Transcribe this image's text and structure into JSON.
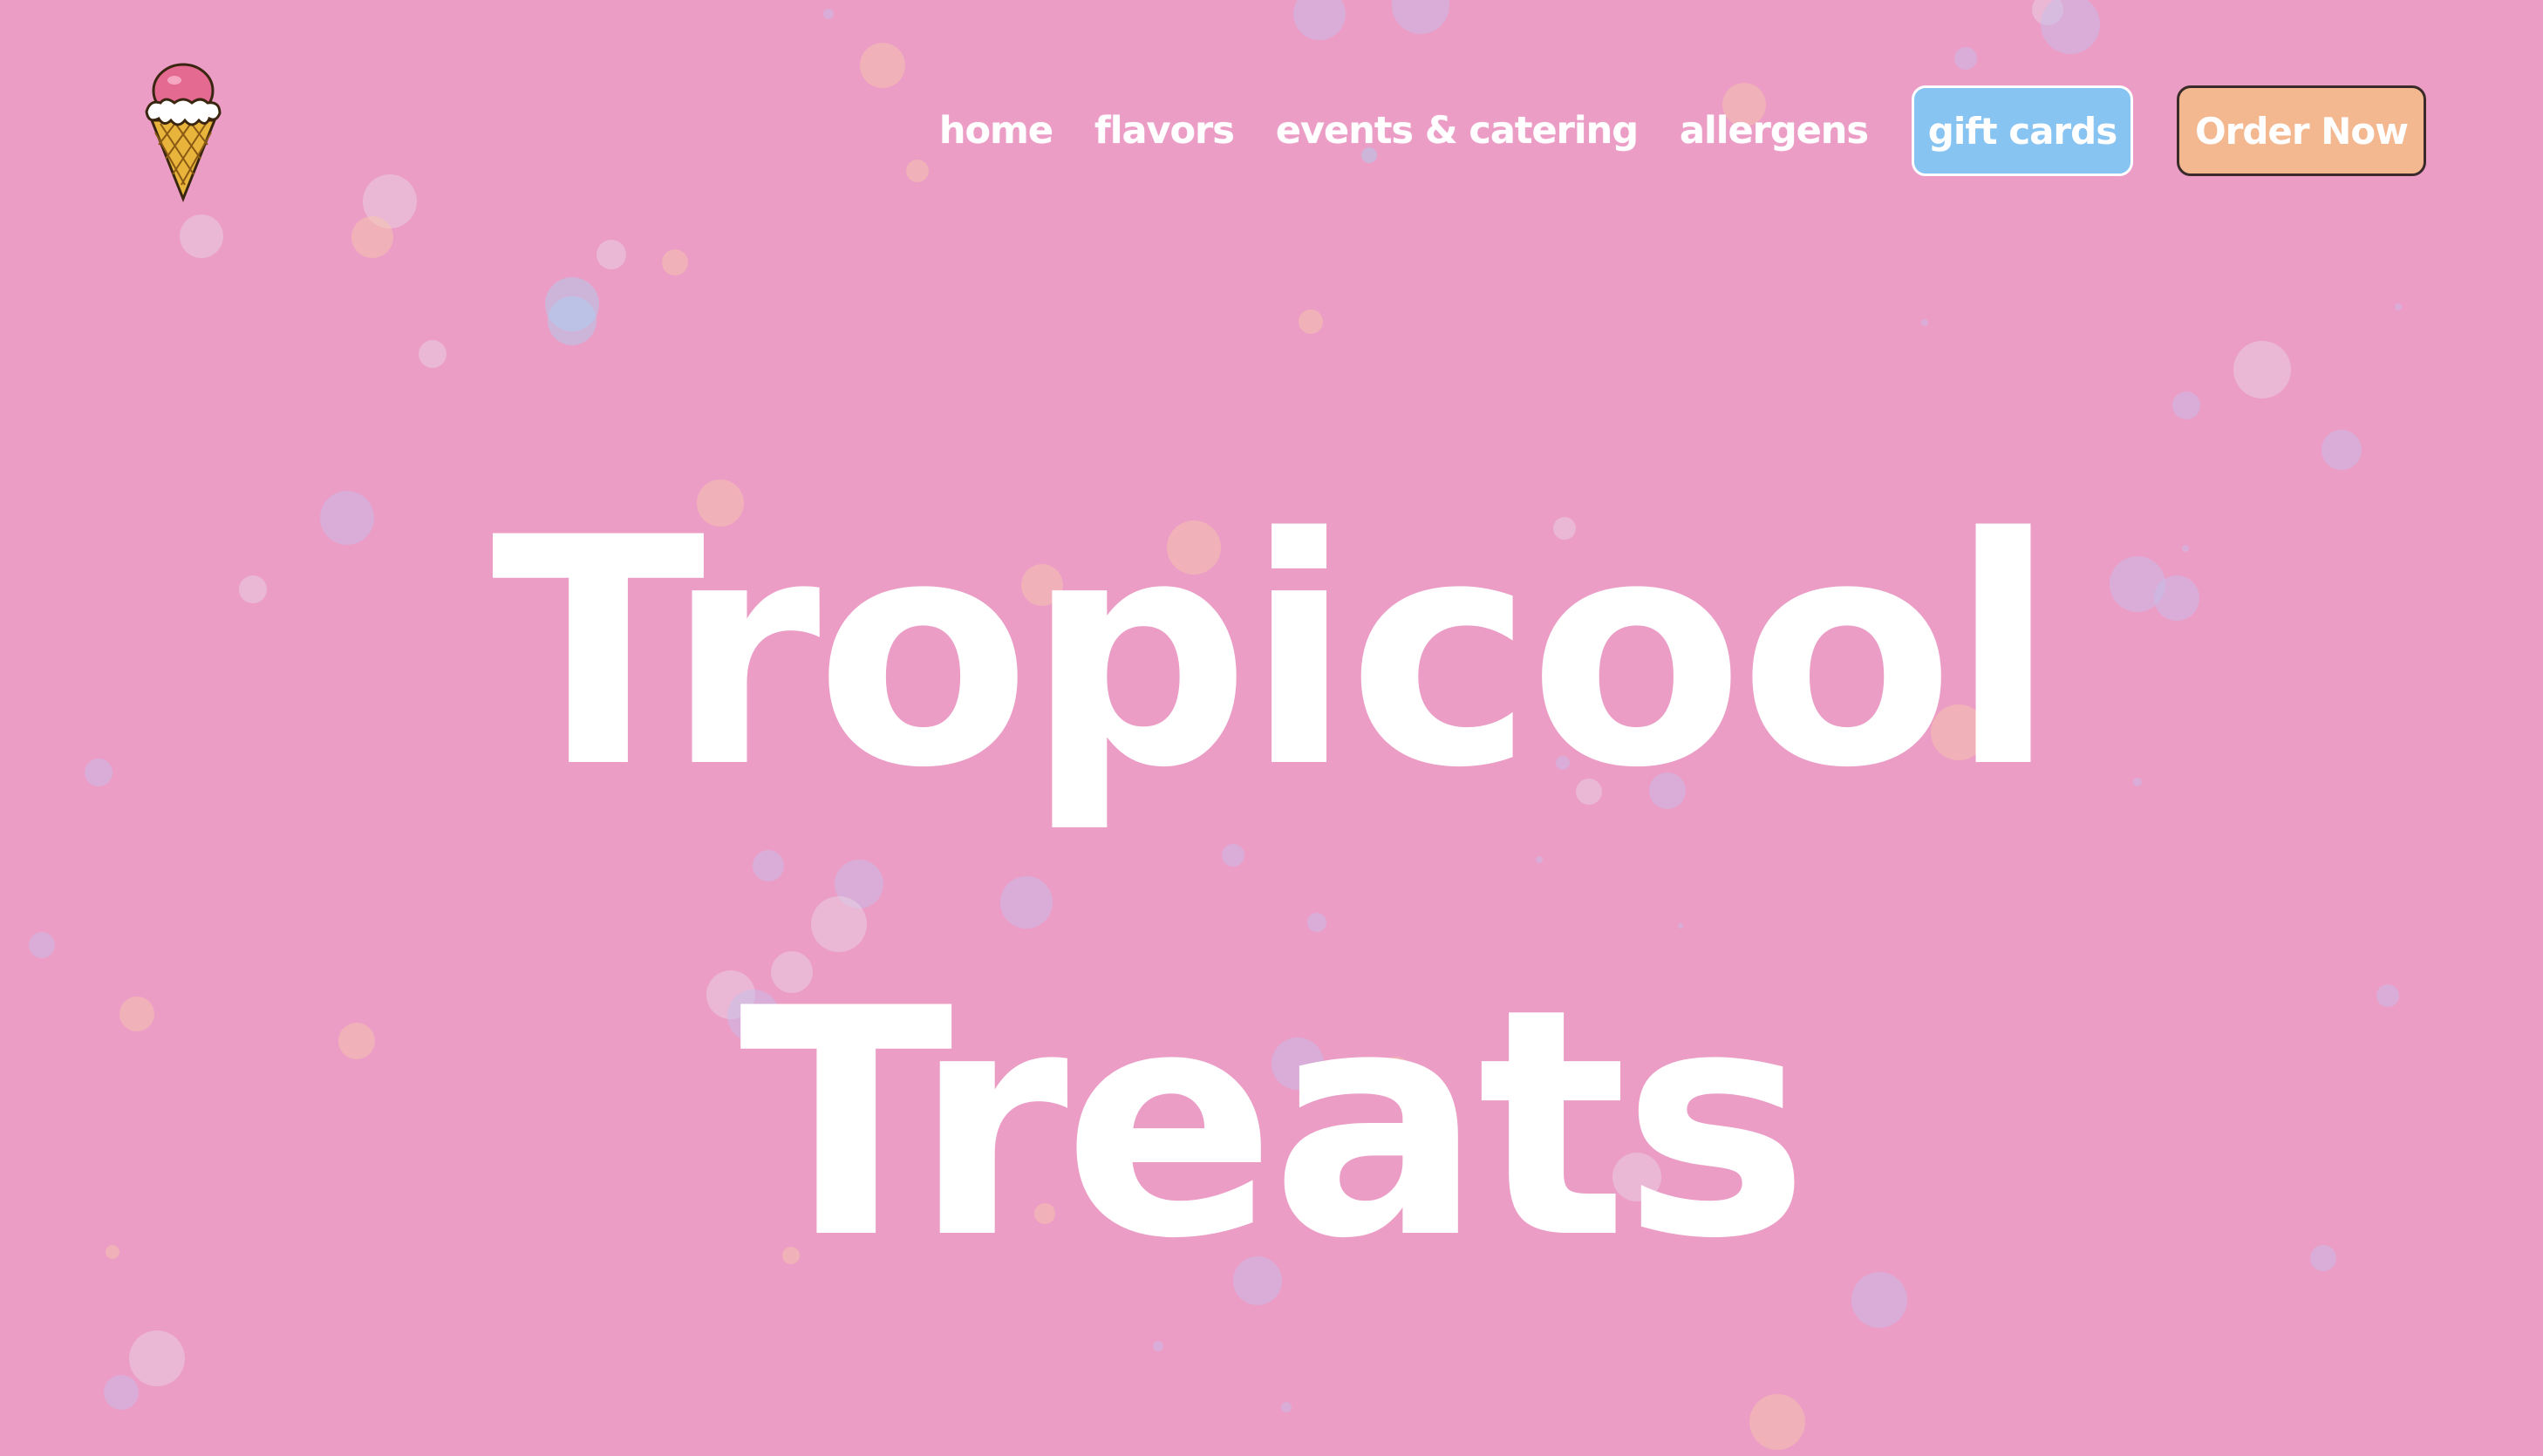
{
  "nav": {
    "links": [
      {
        "label": "home"
      },
      {
        "label": "flavors"
      },
      {
        "label": "events & catering"
      },
      {
        "label": "allergens"
      }
    ],
    "gift_cards_label": "gift cards",
    "order_now_label": "Order Now"
  },
  "hero": {
    "line1": "Tropicool",
    "line2": "Treats"
  },
  "colors": {
    "background": "#eb9dc6",
    "gift_button": "#88c4f2",
    "order_button": "#f3b88f",
    "text": "#ffffff"
  },
  "icons": {
    "logo": "ice-cream-cone-icon"
  }
}
